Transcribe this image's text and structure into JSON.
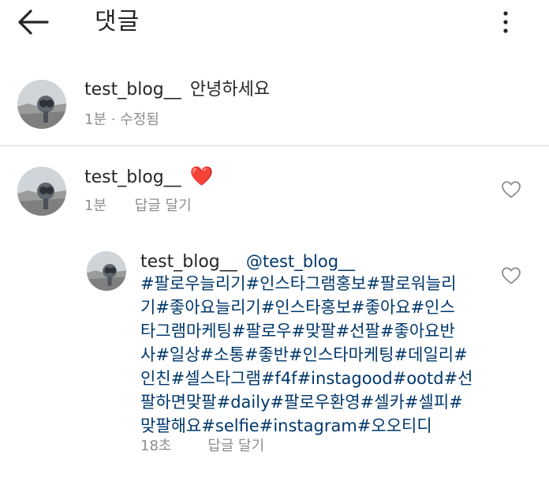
{
  "header": {
    "title": "댓글",
    "back_icon": "arrow-left-icon",
    "more_icon": "more-vertical-icon"
  },
  "comments": [
    {
      "username": "test_blog__",
      "text": "안녕하세요",
      "meta": "1분 · 수정됨"
    },
    {
      "username": "test_blog__",
      "text": "❤️",
      "time": "1분",
      "reply_label": "답글 달기",
      "like_icon": "heart-outline-icon"
    }
  ],
  "reply": {
    "username": "test_blog__",
    "mention": "@test_blog__",
    "lines": [
      "#팔로우늘리기#인스타그램홍보#팔로워늘리",
      "기#좋아요늘리기#인스타홍보#좋아요#인스",
      "타그램마케팅#팔로우#맞팔#선팔#좋아요반",
      "사#일상#소통#좋반#인스타마케팅#데일리#",
      "인친#셀스타그램#f4f#instagood#ootd#선",
      "팔하면맞팔#daily#팔로우환영#셀카#셀피#",
      "맞팔해요#selfie#instagram#오오티디"
    ],
    "time": "18초",
    "reply_label": "답글 달기",
    "like_icon": "heart-outline-icon"
  },
  "colors": {
    "text": "#262626",
    "secondary": "#8e8e8e",
    "hashtag": "#00376b",
    "divider": "#dbdbdb",
    "heart": "#ed4956"
  }
}
